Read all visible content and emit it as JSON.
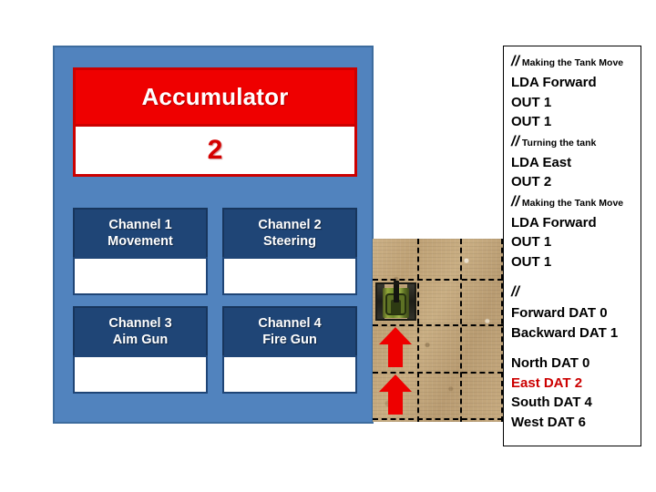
{
  "control_panel": {
    "accumulator": {
      "label": "Accumulator",
      "value": "2",
      "header_color": "#ef0000",
      "value_color": "#d40000"
    },
    "panel_color": "#5183be",
    "channels": [
      {
        "title": "Channel 1",
        "subtitle": "Movement",
        "value": ""
      },
      {
        "title": "Channel 2",
        "subtitle": "Steering",
        "value": ""
      },
      {
        "title": "Channel 3",
        "subtitle": "Aim Gun",
        "value": ""
      },
      {
        "title": "Channel 4",
        "subtitle": "Fire Gun",
        "value": ""
      }
    ]
  },
  "battlefield": {
    "tank": {
      "name": "tank-sprite",
      "facing": "up"
    },
    "arrows": [
      {
        "name": "move-arrow-up",
        "direction": "up"
      },
      {
        "name": "move-arrow-up",
        "direction": "up"
      }
    ]
  },
  "code_panel": {
    "lines": [
      {
        "type": "comment",
        "slashes": "//",
        "text": "Making the Tank Move"
      },
      {
        "type": "code",
        "text": "LDA Forward"
      },
      {
        "type": "code",
        "text": "OUT 1"
      },
      {
        "type": "code",
        "text": "OUT 1"
      },
      {
        "type": "comment",
        "slashes": "//",
        "text": "Turning the tank"
      },
      {
        "type": "code",
        "text": "LDA East"
      },
      {
        "type": "code",
        "text": "OUT 2"
      },
      {
        "type": "comment",
        "slashes": "//",
        "text": "Making the Tank Move"
      },
      {
        "type": "code",
        "text": "LDA Forward"
      },
      {
        "type": "code",
        "text": "OUT 1"
      },
      {
        "type": "code",
        "text": "OUT 1"
      },
      {
        "type": "gap",
        "text": ""
      },
      {
        "type": "comment",
        "slashes": "//",
        "text": ""
      },
      {
        "type": "code",
        "text": "Forward DAT 0"
      },
      {
        "type": "code",
        "text": "Backward DAT 1"
      },
      {
        "type": "gap",
        "text": ""
      },
      {
        "type": "code",
        "text": "North DAT 0"
      },
      {
        "type": "code",
        "text": "East DAT 2",
        "highlight": true
      },
      {
        "type": "code",
        "text": "South DAT 4"
      },
      {
        "type": "code",
        "text": "West DAT 6"
      }
    ],
    "highlight_color": "#cc0000"
  }
}
